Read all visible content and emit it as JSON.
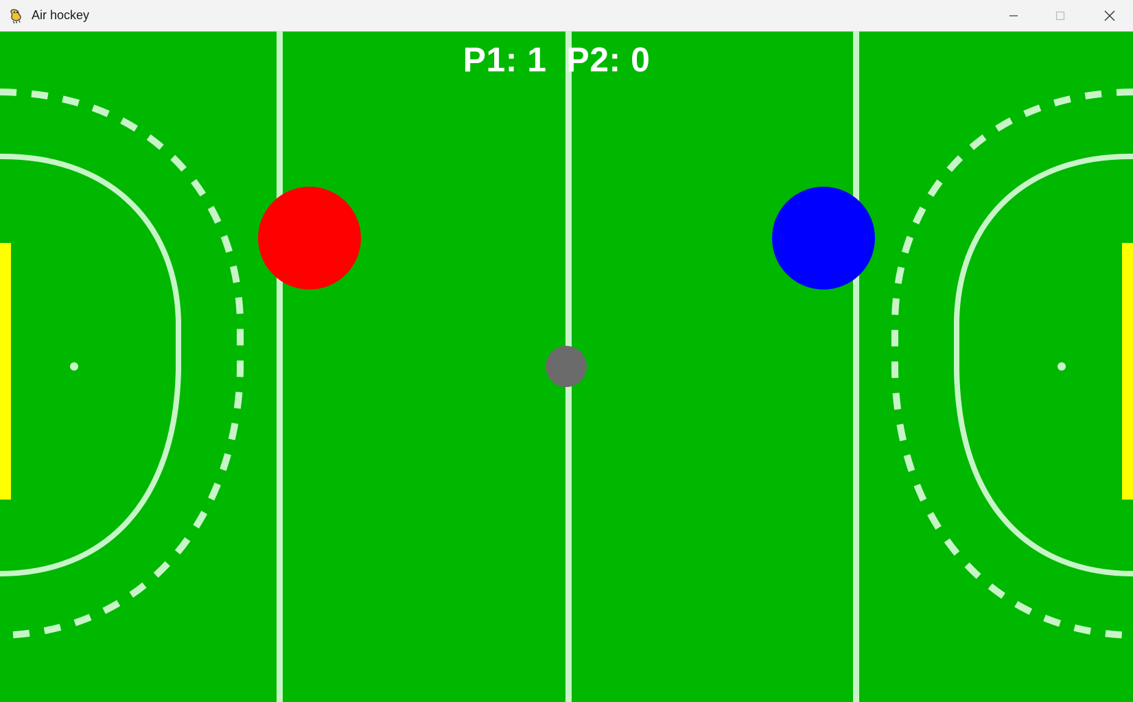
{
  "window": {
    "title": "Air hockey",
    "icon": "pygame-snake-icon",
    "controls": [
      "minimize-icon",
      "maximize-icon",
      "close-icon"
    ]
  },
  "scoreboard": {
    "text": "P1: 1  P2: 0",
    "p1_score": 1,
    "p2_score": 0
  },
  "colors": {
    "field": "#00b800",
    "lines": "#c8f5c8",
    "player1_mallet": "#ff0000",
    "player2_mallet": "#0000ff",
    "puck": "#6b6b6b",
    "goals": "#ffff00",
    "score_text": "#ffffff"
  }
}
